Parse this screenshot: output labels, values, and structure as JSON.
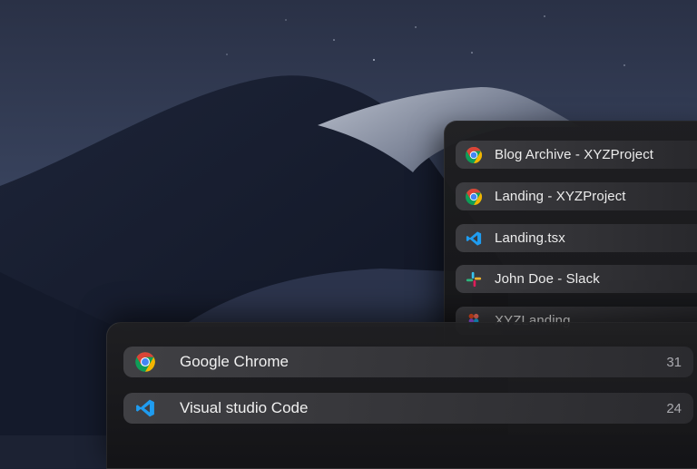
{
  "window_list": {
    "items": [
      {
        "label": "Blog Archive - XYZProject",
        "icon": "chrome-icon"
      },
      {
        "label": "Landing - XYZProject",
        "icon": "chrome-icon"
      },
      {
        "label": "Landing.tsx",
        "icon": "vscode-icon"
      },
      {
        "label": "John Doe - Slack",
        "icon": "slack-icon"
      },
      {
        "label": "XYZLanding",
        "icon": "figma-icon"
      }
    ]
  },
  "app_switcher": {
    "items": [
      {
        "label": "Google Chrome",
        "count": "31",
        "icon": "chrome-icon"
      },
      {
        "label": "Visual studio Code",
        "count": "24",
        "icon": "vscode-icon"
      }
    ]
  },
  "colors": {
    "chrome_red": "#db4437",
    "chrome_yellow": "#f4b400",
    "chrome_green": "#0f9d58",
    "chrome_blue": "#4285f4",
    "vscode_blue": "#1f9cf0"
  }
}
